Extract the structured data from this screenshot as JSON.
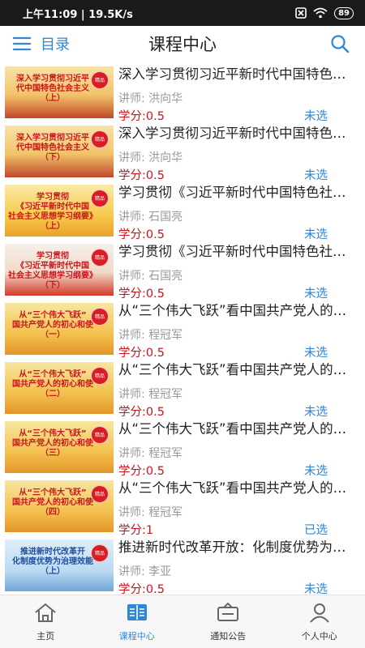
{
  "status_bar": {
    "time": "上午11:09",
    "network_speed": "19.5K/s",
    "battery": "89"
  },
  "header": {
    "menu_label": "目录",
    "title": "课程中心"
  },
  "courses": [
    {
      "thumb_text": "深入学习贯彻习近平\n代中国特色社会主义\n（上）",
      "badge": "精品",
      "title": "深入学习贯彻习近平新时代中国特色社会主义思想（上）",
      "teacher": "讲师: 洪向华",
      "credit": "学分:0.5",
      "status": "未选",
      "bg": "linear-gradient(180deg,#f8e3a8 0%,#f2c36a 55%,#c0482a 100%)"
    },
    {
      "thumb_text": "深入学习贯彻习近平\n代中国特色社会主义\n（下）",
      "badge": "精品",
      "title": "深入学习贯彻习近平新时代中国特色社会主义思想（下）",
      "teacher": "讲师: 洪向华",
      "credit": "学分:0.5",
      "status": "未选",
      "bg": "linear-gradient(180deg,#f8e3a8 0%,#f2c36a 55%,#c0482a 100%)"
    },
    {
      "thumb_text": "学习贯彻\n《习近平新时代中国\n社会主义思想学习纲要》\n（上）",
      "badge": "精品",
      "title": "学习贯彻《习近平新时代中国特色社会主义思想学习纲要》（上）",
      "teacher": "讲师: 石国亮",
      "credit": "学分:0.5",
      "status": "未选",
      "bg": "linear-gradient(180deg,#fbeaa5 0%,#f6c94a 60%,#e8a22a 100%)"
    },
    {
      "thumb_text": "学习贯彻\n《习近平新时代中国\n社会主义思想学习纲要》\n（下）",
      "badge": "精品",
      "title": "学习贯彻《习近平新时代中国特色社会主义思想学习纲要》（下）",
      "teacher": "讲师: 石国亮",
      "credit": "学分:0.5",
      "status": "未选",
      "bg": "linear-gradient(180deg,#f5f0ea 0%,#f1d9c8 55%,#d13a2a 100%)"
    },
    {
      "thumb_text": "从“三个伟大飞跃”\n国共产党人的初心和使\n（一）",
      "badge": "精品",
      "title": "从“三个伟大飞跃”看中国共产党人的初心和使命（一）",
      "teacher": "讲师: 程冠军",
      "credit": "学分:0.5",
      "status": "未选",
      "bg": "linear-gradient(180deg,#f7e6a0 0%,#f3c14e 60%,#e3962a 100%)"
    },
    {
      "thumb_text": "从“三个伟大飞跃”\n国共产党人的初心和使\n（二）",
      "badge": "精品",
      "title": "从“三个伟大飞跃”看中国共产党人的初心和使命（二）",
      "teacher": "讲师: 程冠军",
      "credit": "学分:0.5",
      "status": "未选",
      "bg": "linear-gradient(180deg,#f7e6a0 0%,#f3c14e 60%,#e3962a 100%)"
    },
    {
      "thumb_text": "从“三个伟大飞跃”\n国共产党人的初心和使\n（三）",
      "badge": "精品",
      "title": "从“三个伟大飞跃”看中国共产党人的初心和使命（三）",
      "teacher": "讲师: 程冠军",
      "credit": "学分:0.5",
      "status": "未选",
      "bg": "linear-gradient(180deg,#f7e6a0 0%,#f3c14e 60%,#e3962a 100%)"
    },
    {
      "thumb_text": "从“三个伟大飞跃”\n国共产党人的初心和使\n（四）",
      "badge": "精品",
      "title": "从“三个伟大飞跃”看中国共产党人的初心和使命（四）",
      "teacher": "讲师: 程冠军",
      "credit": "学分:1",
      "status": "已选",
      "bg": "linear-gradient(180deg,#f7e6a0 0%,#f3c14e 60%,#e3962a 100%)"
    },
    {
      "thumb_text": "推进新时代改革开\n化制度优势为治理效能\n（上）",
      "badge": "精品",
      "title": "推进新时代改革开放：化制度优势为治理效能（上）",
      "teacher": "讲师: 李亚",
      "credit": "学分:0.5",
      "status": "未选",
      "bg": "linear-gradient(180deg,#dfeefa 0%,#bcdaf2 60%,#6fa6d8 100%)",
      "text_color": "#1d4f9a"
    }
  ],
  "tabs": [
    {
      "label": "主页",
      "icon": "home-icon",
      "active": false
    },
    {
      "label": "课程中心",
      "icon": "book-icon",
      "active": true
    },
    {
      "label": "通知公告",
      "icon": "notice-icon",
      "active": false
    },
    {
      "label": "个人中心",
      "icon": "user-icon",
      "active": false
    }
  ],
  "colors": {
    "accent": "#2f86d6",
    "credit": "#c8161e",
    "badge": "#d81e24"
  }
}
